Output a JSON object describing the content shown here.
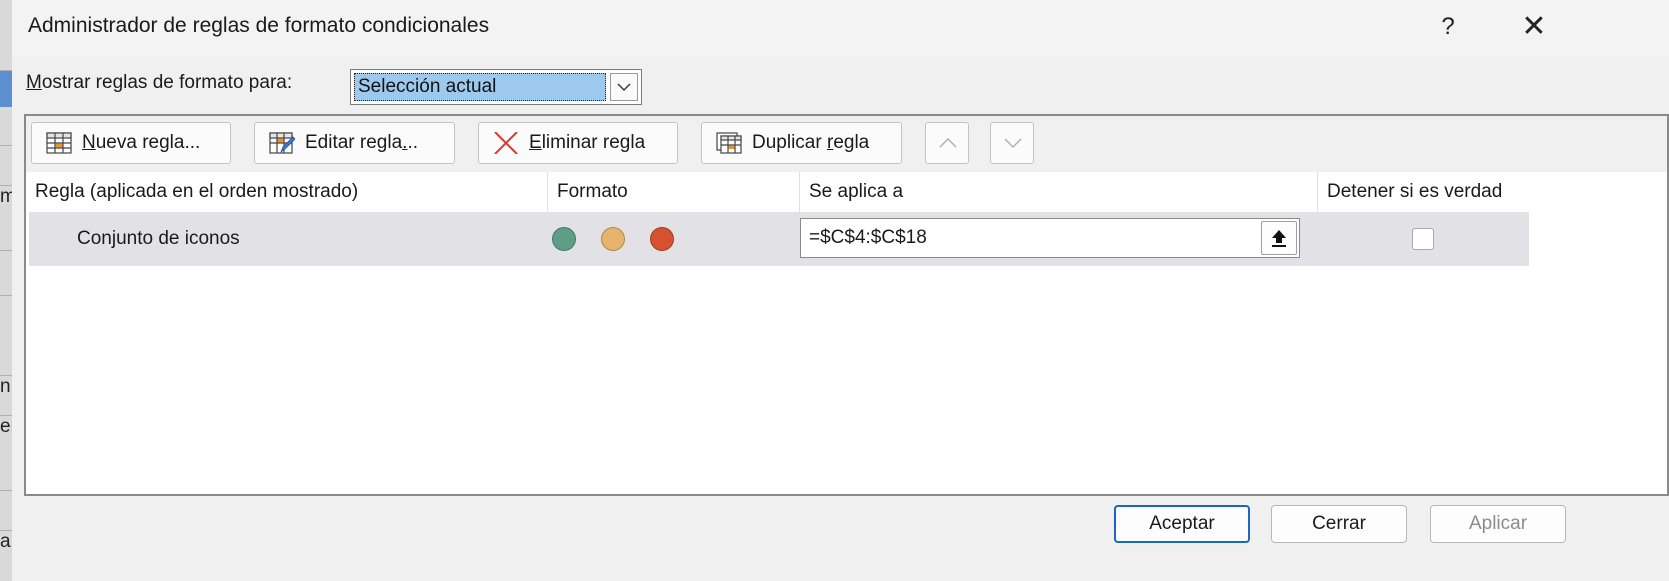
{
  "dialog": {
    "title": "Administrador de reglas de formato condicionales",
    "help_glyph": "?",
    "close_glyph": "✕"
  },
  "show_rules": {
    "label_accel": "M",
    "label_rest": "ostrar reglas de formato para:",
    "selected": "Selección actual"
  },
  "toolbar": {
    "new_rule_accel": "N",
    "new_rule_rest": "ueva regla...",
    "edit_rule_pre": "Editar regla",
    "edit_rule_accel": ".",
    "edit_rule_post": "..",
    "delete_rule_accel": "E",
    "delete_rule_rest": "liminar regla",
    "duplicate_rule_pre": "Duplicar ",
    "duplicate_rule_accel": "r",
    "duplicate_rule_post": "egla"
  },
  "grid": {
    "columns": [
      "Regla (aplicada en el orden mostrado)",
      "Formato",
      "Se aplica a",
      "Detener si es verdad"
    ],
    "rows": [
      {
        "rule": "Conjunto de iconos",
        "format_icons": [
          "green-circle-icon",
          "yellow-circle-icon",
          "red-circle-icon"
        ],
        "applies_to": "=$C$4:$C$18",
        "stop_if_true": false
      }
    ]
  },
  "colors": {
    "dot_green": "#5e9e86",
    "dot_yellow": "#e6b56b",
    "dot_red": "#d6522f",
    "selection_blue": "#9dc9ee",
    "default_button_border": "#1967c2"
  },
  "footer": {
    "ok": "Aceptar",
    "close": "Cerrar",
    "apply": "Aplicar"
  },
  "background_sheet": {
    "fragments": [
      "m",
      "n",
      "er",
      "a"
    ]
  }
}
